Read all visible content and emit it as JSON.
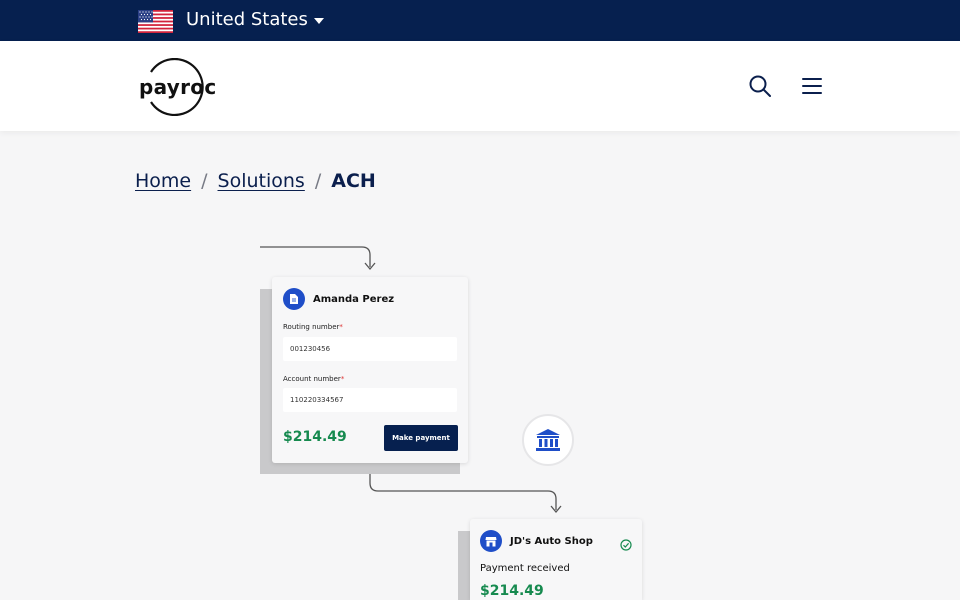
{
  "topbar": {
    "country": "United States",
    "flag_icon": "us-flag-icon"
  },
  "header": {
    "logo_text": "payroc",
    "search_icon": "search-icon",
    "menu_icon": "hamburger-menu-icon"
  },
  "breadcrumb": {
    "items": [
      "Home",
      "Solutions"
    ],
    "separator": "/",
    "current": "ACH"
  },
  "illustration": {
    "payer_card": {
      "name": "Amanda Perez",
      "routing_label": "Routing number",
      "routing_value": "001230456",
      "account_label": "Account number",
      "account_value": "110220334567",
      "required_mark": "*",
      "amount": "$214.49",
      "button_label": "Make payment"
    },
    "merchant_card": {
      "name": "JD's Auto Shop",
      "status": "Payment received",
      "amount": "$214.49"
    }
  },
  "colors": {
    "navy": "#06204f",
    "accent_blue": "#1f4ec8",
    "amount_green": "#168a4f",
    "page_bg": "#f6f6f7"
  }
}
